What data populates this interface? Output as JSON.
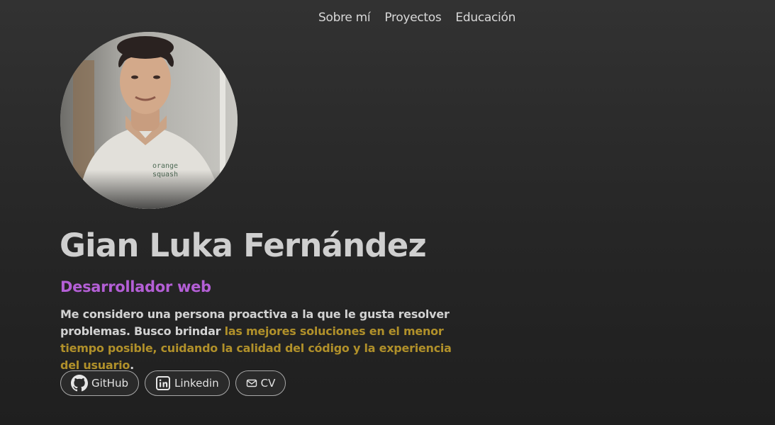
{
  "nav": {
    "items": [
      {
        "label": "Sobre mí"
      },
      {
        "label": "Proyectos"
      },
      {
        "label": "Educación"
      }
    ]
  },
  "profile": {
    "photo_shirt_text": [
      "orange",
      "squash"
    ],
    "name": "Gian Luka Fernández",
    "role": "Desarrollador web",
    "bio_plain": "Me considero una persona proactiva a la que le gusta resolver problemas. Busco brindar ",
    "bio_highlight": "las mejores soluciones en el menor tiempo posible, cuidando la calidad del código y la experiencia del usuario",
    "bio_end": "."
  },
  "links": [
    {
      "label": "GitHub",
      "icon": "github-icon"
    },
    {
      "label": "Linkedin",
      "icon": "linkedin-icon"
    },
    {
      "label": "CV",
      "icon": "mail-icon"
    }
  ],
  "colors": {
    "background": "#2b2b2b",
    "name": "#cfcfcf",
    "role": "#b45fd6",
    "highlight": "#b0902a",
    "pill_border": "#a8a8a8"
  }
}
